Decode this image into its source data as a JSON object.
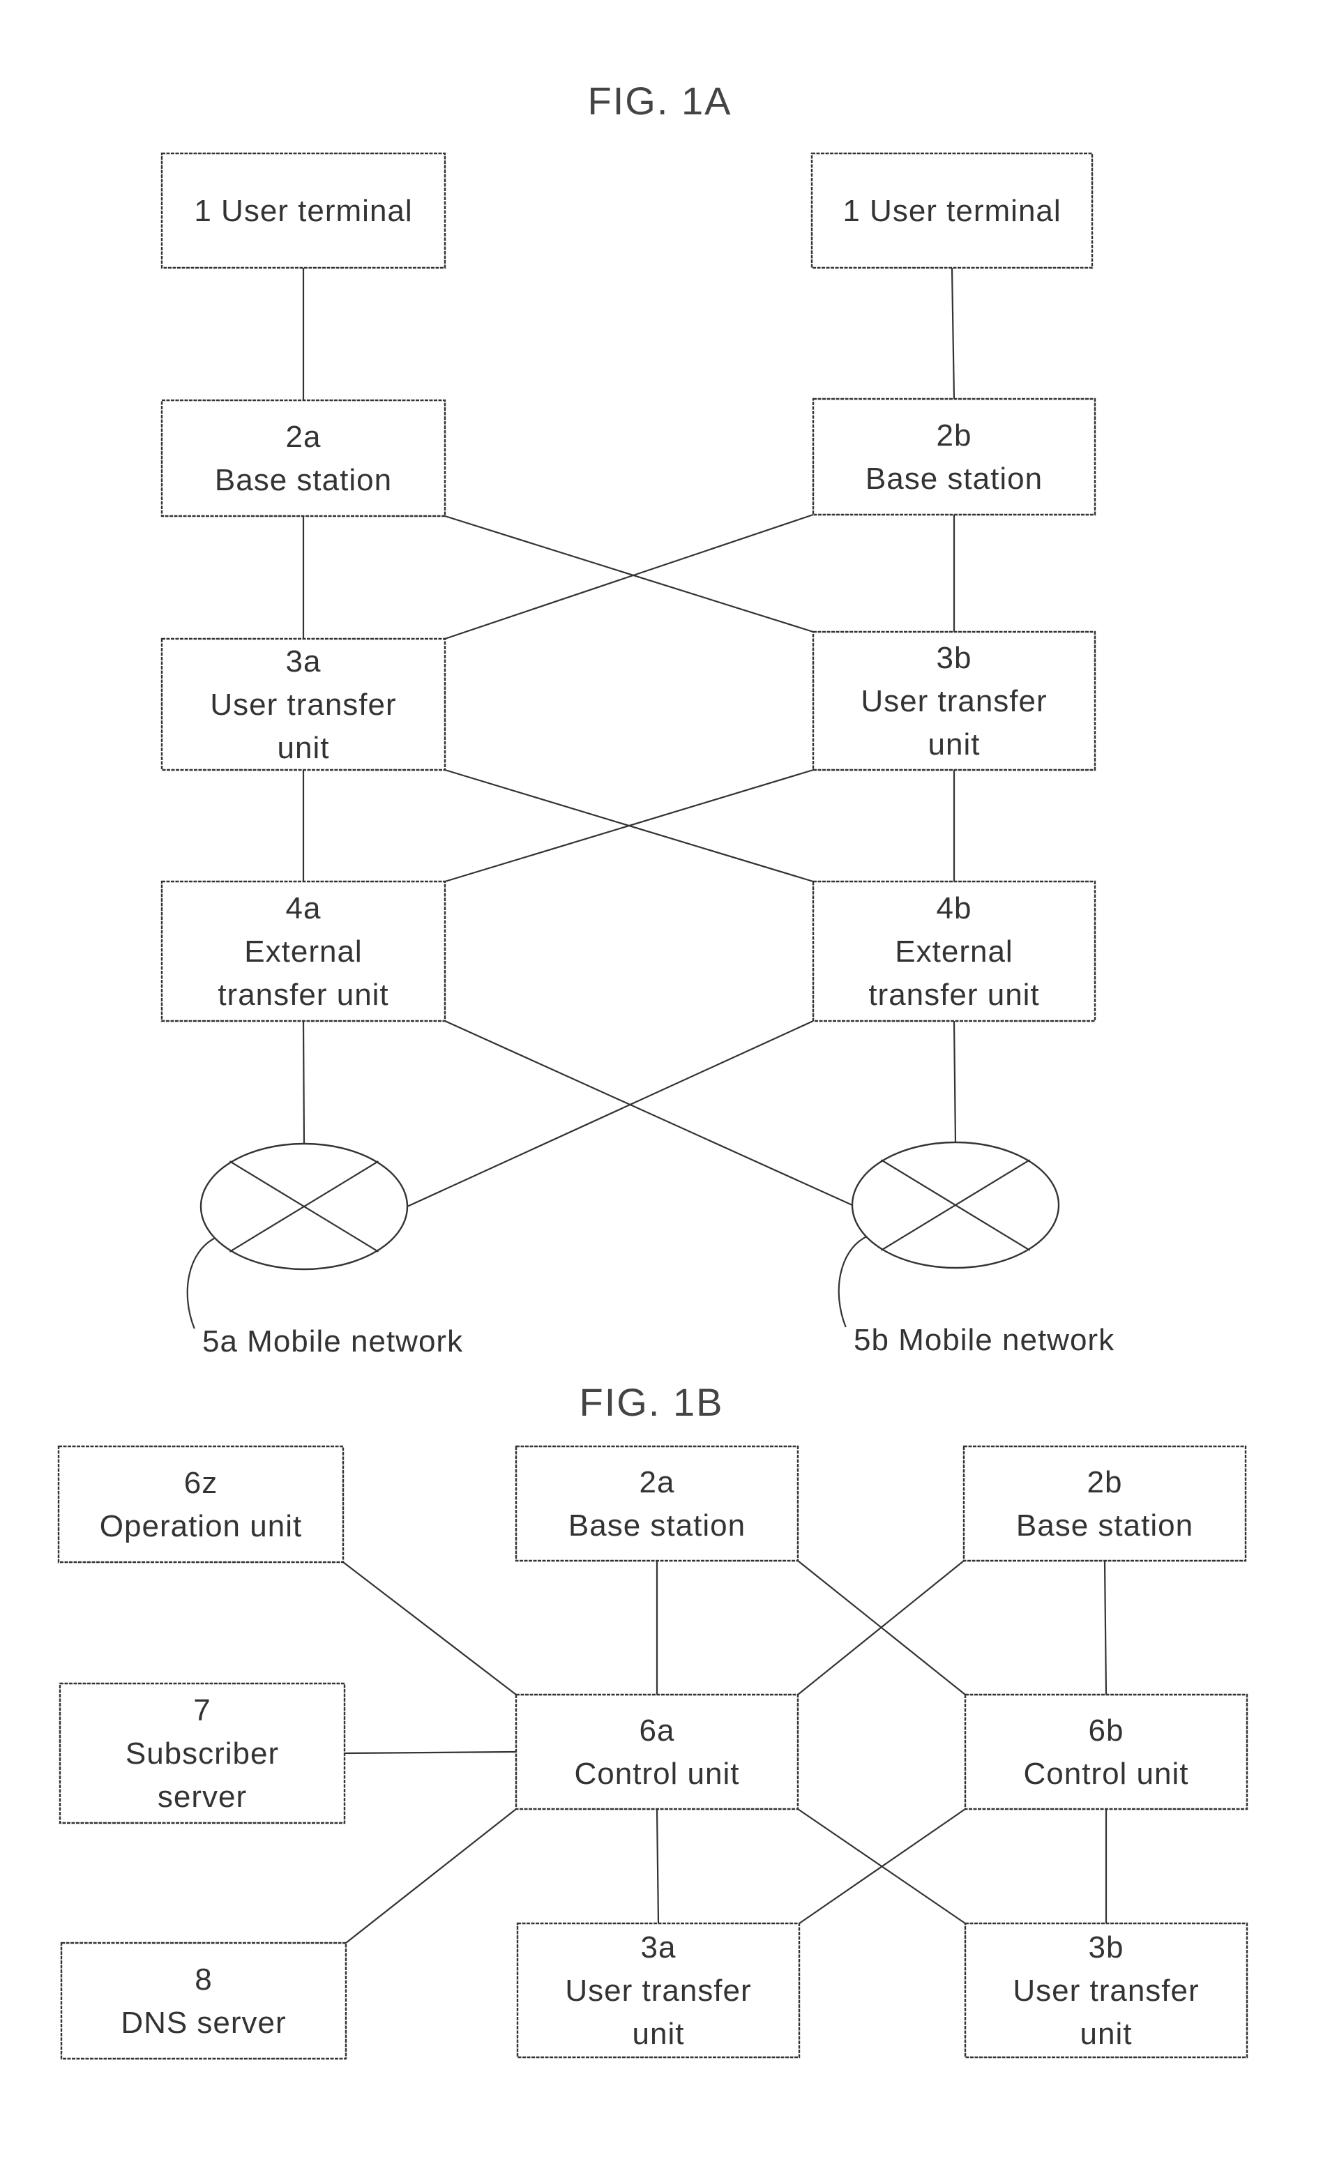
{
  "fig1a": {
    "title": "FIG. 1A",
    "nodes": {
      "ut_left": [
        "1 User terminal"
      ],
      "ut_right": [
        "1 User terminal"
      ],
      "bs_2a": [
        "2a",
        "Base station"
      ],
      "bs_2b": [
        "2b",
        "Base station"
      ],
      "utu_3a": [
        "3a",
        "User transfer",
        "unit"
      ],
      "utu_3b": [
        "3b",
        "User transfer",
        "unit"
      ],
      "etu_4a": [
        "4a",
        "External",
        "transfer unit"
      ],
      "etu_4b": [
        "4b",
        "External",
        "transfer unit"
      ]
    },
    "networks": {
      "net_5a": "5a  Mobile network",
      "net_5b": "5b  Mobile network"
    },
    "edges": [
      [
        "ut_left",
        "bs_2a"
      ],
      [
        "ut_right",
        "bs_2b"
      ],
      [
        "bs_2a",
        "utu_3a"
      ],
      [
        "bs_2b",
        "utu_3b"
      ],
      [
        "bs_2a",
        "utu_3b"
      ],
      [
        "bs_2b",
        "utu_3a"
      ],
      [
        "utu_3a",
        "etu_4a"
      ],
      [
        "utu_3b",
        "etu_4b"
      ],
      [
        "utu_3a",
        "etu_4b"
      ],
      [
        "utu_3b",
        "etu_4a"
      ],
      [
        "etu_4a",
        "net_5a"
      ],
      [
        "etu_4b",
        "net_5b"
      ],
      [
        "etu_4a",
        "net_5b"
      ],
      [
        "etu_4b",
        "net_5a"
      ]
    ]
  },
  "fig1b": {
    "title": "FIG. 1B",
    "nodes": {
      "op_6z": [
        "6z",
        "Operation unit"
      ],
      "bs_2a": [
        "2a",
        "Base station"
      ],
      "bs_2b": [
        "2b",
        "Base station"
      ],
      "sub_7": [
        "7",
        "Subscriber",
        "server"
      ],
      "cu_6a": [
        "6a",
        "Control unit"
      ],
      "cu_6b": [
        "6b",
        "Control unit"
      ],
      "dns_8": [
        "8",
        "DNS server"
      ],
      "utu_3a": [
        "3a",
        "User transfer",
        "unit"
      ],
      "utu_3b": [
        "3b",
        "User transfer",
        "unit"
      ]
    },
    "edges": [
      [
        "op_6z",
        "cu_6a"
      ],
      [
        "sub_7",
        "cu_6a"
      ],
      [
        "dns_8",
        "cu_6a"
      ],
      [
        "bs_2a",
        "cu_6a"
      ],
      [
        "bs_2b",
        "cu_6b"
      ],
      [
        "bs_2a",
        "cu_6b"
      ],
      [
        "bs_2b",
        "cu_6a"
      ],
      [
        "cu_6a",
        "utu_3a"
      ],
      [
        "cu_6b",
        "utu_3b"
      ],
      [
        "cu_6a",
        "utu_3b"
      ],
      [
        "cu_6b",
        "utu_3a"
      ]
    ]
  }
}
